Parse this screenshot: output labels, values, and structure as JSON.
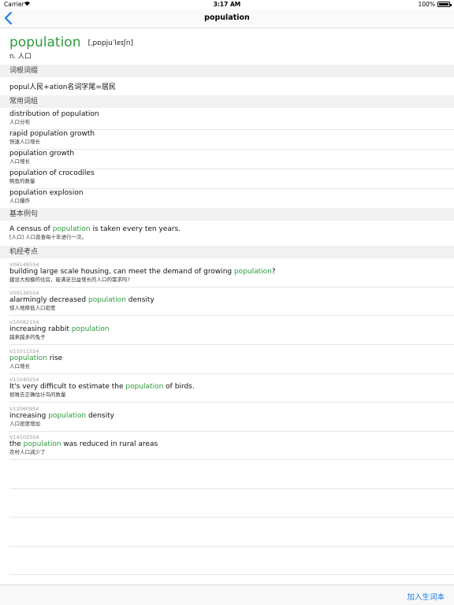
{
  "status_bar": {
    "carrier": "Carrier",
    "wifi_icon": "wifi-icon",
    "time": "3:17 AM",
    "battery": "100%"
  },
  "nav": {
    "back_icon": "chevron-left-icon",
    "title": "population"
  },
  "headword": {
    "word": "population",
    "phonetic": "[ˌpɒpjuˈleɪʃn]",
    "pos": "n. 人口"
  },
  "sections": {
    "root": "词根词缀",
    "phrases": "常用词组",
    "examples": "基本例句",
    "exam": "机经考点"
  },
  "root_text": "popul人民+ation名词字尾=居民",
  "phrases": [
    {
      "en": "distribution of population",
      "zh": "人口分布"
    },
    {
      "en": "rapid population growth",
      "zh": "快速人口增长"
    },
    {
      "en": "population growth",
      "zh": "人口增长"
    },
    {
      "en": "population of crocodiles",
      "zh": "鳄鱼的数量"
    },
    {
      "en": "population explosion",
      "zh": "人口爆炸"
    }
  ],
  "example": {
    "pre": "A census of ",
    "hl": "population",
    "post": " is taken every ten years.",
    "zh": "[人口] 人口普查每十年进行一次。"
  },
  "exam_points": [
    {
      "code": "V061485S4",
      "pre": "building large scale housing, can meet the demand of growing ",
      "hl": "population",
      "post": "?",
      "zh": "建设大规模的住房，能满足日益增长的人口的需求吗?"
    },
    {
      "code": "V091365S4",
      "pre": "alarmingly decreased ",
      "hl": "population",
      "post": " density",
      "zh": "惊人地降低人口密度"
    },
    {
      "code": "V100821S4",
      "pre": "increasing rabbit ",
      "hl": "population",
      "post": "",
      "zh": "越来越多的兔子"
    },
    {
      "code": "V110115S4",
      "pre": "",
      "hl": "population",
      "post": " rise",
      "zh": "人口增长"
    },
    {
      "code": "V110402S4",
      "pre": "It's very difficult to estimate the ",
      "hl": "population",
      "post": " of birds.",
      "zh": "很难去正确估计鸟的数量"
    },
    {
      "code": "V120609S4",
      "pre": "increasing ",
      "hl": "population",
      "post": " density",
      "zh": "人口密度增加"
    },
    {
      "code": "V141025S4",
      "pre": "the ",
      "hl": "population",
      "post": " was reduced in rural areas",
      "zh": "农村人口减少了"
    }
  ],
  "toolbar": {
    "add_label": "加入生词本"
  },
  "colors": {
    "accent_green": "#2e9a3e",
    "link_blue": "#1a7fe8"
  }
}
